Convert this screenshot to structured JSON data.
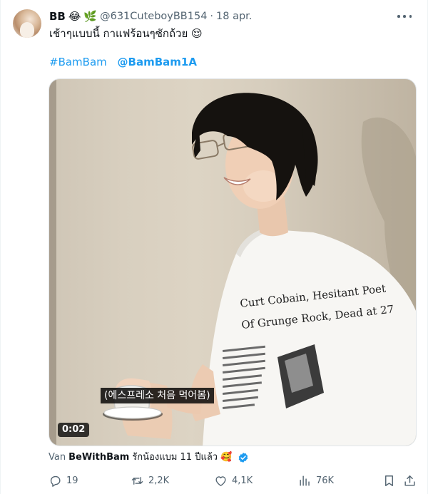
{
  "tweet": {
    "author_name": "BB",
    "author_emojis": [
      "😂",
      "🌿"
    ],
    "handle": "@631CuteboyBB154",
    "separator": "·",
    "date": "18 apr.",
    "text": "เช้าๆแบบนี้ กาแฟร้อนๆซักถ้วย 😌",
    "hashtag": "#BamBam",
    "mention": "@BamBam1A"
  },
  "media": {
    "shirt_line_1": "Curt Cobain, Hesitant Poet",
    "shirt_line_2": "Of Grunge Rock, Dead at 27",
    "subtitle": "(에스프레소 처음 먹어봄)",
    "duration": "0:02"
  },
  "via": {
    "prefix": "Van",
    "user": "BeWithBam",
    "text": "รักน้องแบม 11 ปีแล้ว 🥰"
  },
  "actions": {
    "replies": "19",
    "reposts": "2,2K",
    "likes": "4,1K",
    "views": "76K"
  },
  "icons": {
    "more": "more-icon",
    "reply": "reply-icon",
    "repost": "repost-icon",
    "like": "like-icon",
    "views": "views-icon",
    "bookmark": "bookmark-icon",
    "share": "share-icon",
    "verified": "verified-icon"
  },
  "colors": {
    "accent": "#1d9bf0",
    "muted": "#536471",
    "text": "#0f1419"
  }
}
